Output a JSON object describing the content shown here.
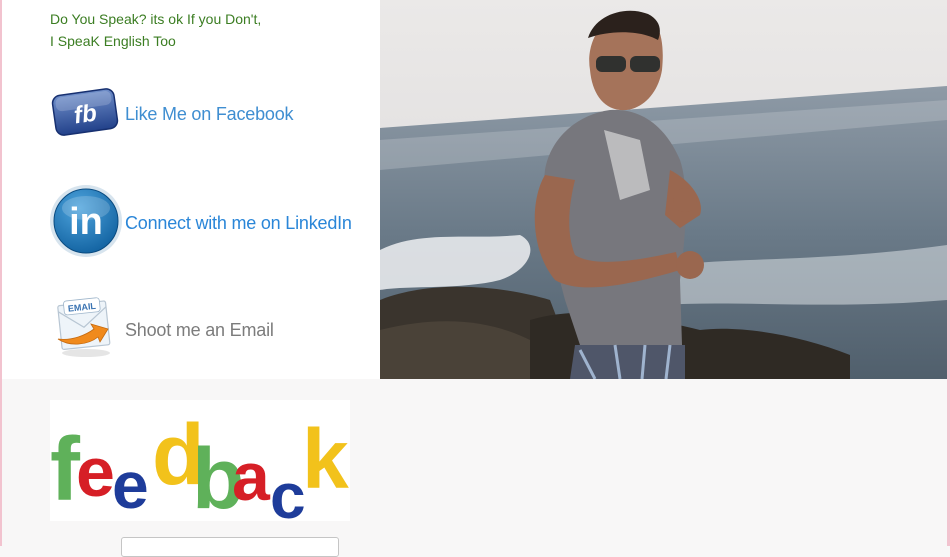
{
  "tagline": {
    "line1": "Do You Speak? its ok If you Don't,",
    "line2": "I SpeaK English Too"
  },
  "social": {
    "facebook": {
      "label": "Like Me on Facebook",
      "icon": "facebook-icon",
      "icon_text": "fb",
      "color": "#3f8ed1"
    },
    "linkedin": {
      "label": "Connect with me on LinkedIn",
      "icon": "linkedin-icon",
      "icon_text": "in",
      "color": "#2a86d8"
    },
    "email": {
      "label": "Shoot me an Email",
      "icon": "email-envelope-icon",
      "icon_text": "EMAIL",
      "color": "#7c7c7c"
    }
  },
  "feedback": {
    "icon": "feedback-logo",
    "letters": [
      "f",
      "e",
      "e",
      "d",
      "b",
      "a",
      "c",
      "k"
    ],
    "letter_colors": [
      "#5fb15a",
      "#d61f26",
      "#1e3c9a",
      "#f2c21b",
      "#5fb15a",
      "#d61f26",
      "#1e3c9a",
      "#f2c21b"
    ]
  },
  "colors": {
    "tagline": "#3b7d22",
    "page_bg": "#f8f7f7",
    "frame": "#f2c3cf"
  }
}
